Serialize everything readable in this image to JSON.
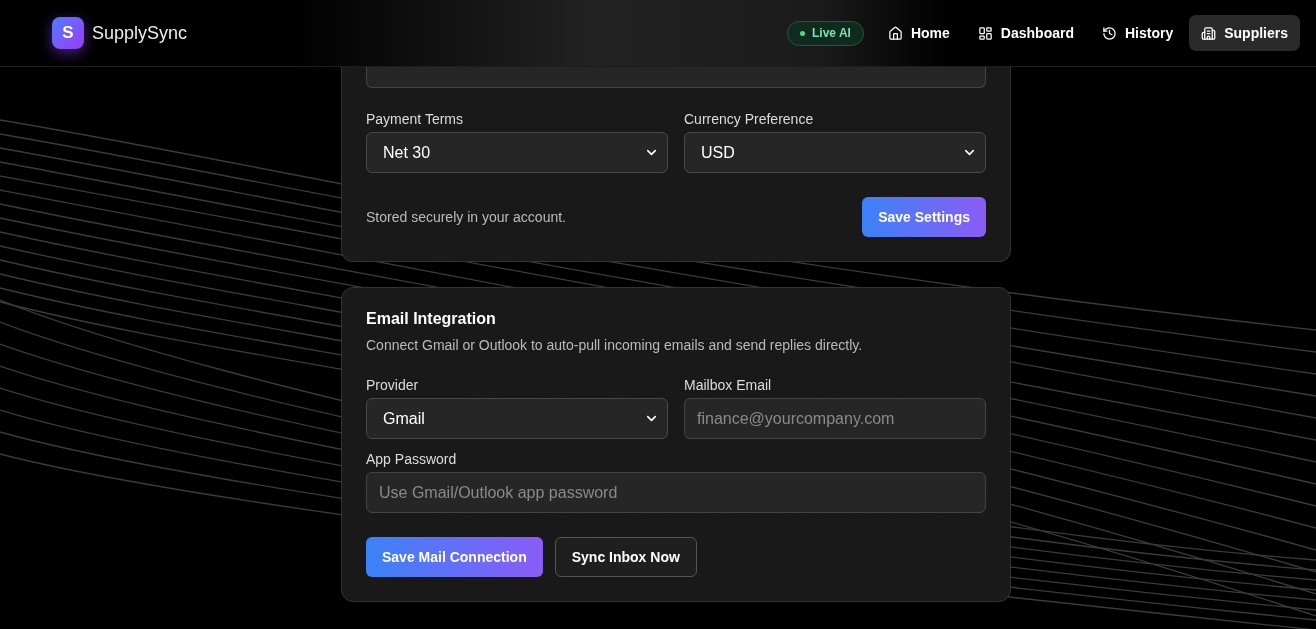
{
  "header": {
    "logo_letter": "S",
    "brand": "SupplySync",
    "status_badge": "Live AI",
    "nav": [
      {
        "label": "Home",
        "selected": false
      },
      {
        "label": "Dashboard",
        "selected": false
      },
      {
        "label": "History",
        "selected": false
      },
      {
        "label": "Suppliers",
        "selected": true
      }
    ]
  },
  "settings_card": {
    "fields": [
      {
        "label": "Payment Terms",
        "kind": "select",
        "value": "Net 30"
      },
      {
        "label": "Currency Preference",
        "kind": "select",
        "value": "USD"
      }
    ],
    "note": "Stored securely in your account.",
    "save_button": "Save Settings"
  },
  "email_card": {
    "title": "Email Integration",
    "description": "Connect Gmail or Outlook to auto-pull incoming emails and send replies directly.",
    "fields": [
      {
        "label": "Provider",
        "kind": "select",
        "value": "Gmail"
      },
      {
        "label": "Mailbox Email",
        "kind": "input",
        "placeholder": "finance@yourcompany.com"
      },
      {
        "label": "App Password",
        "kind": "input",
        "placeholder": "Use Gmail/Outlook app password"
      }
    ],
    "buttons": [
      {
        "label": "Save Mail Connection",
        "kind": "primary"
      },
      {
        "label": "Sync Inbox Now",
        "kind": "secondary"
      }
    ]
  }
}
